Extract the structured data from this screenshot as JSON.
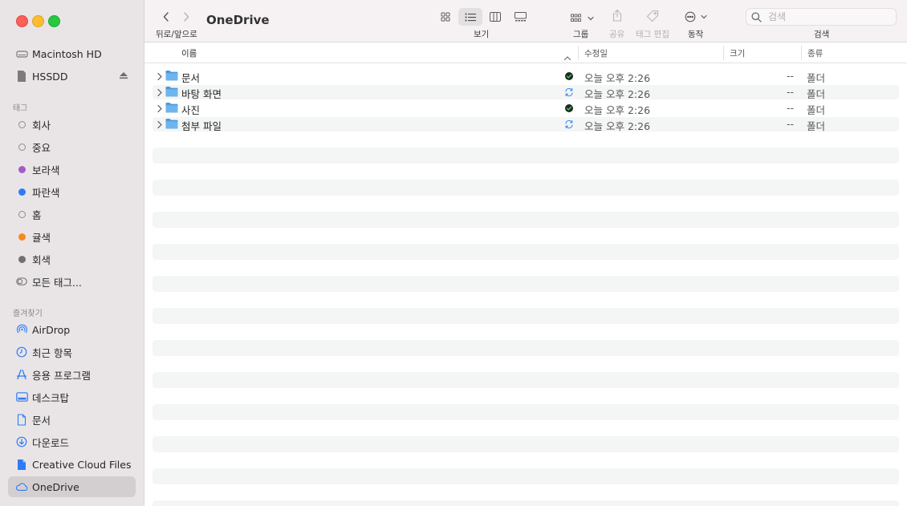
{
  "toolbar": {
    "title": "OneDrive",
    "nav_label": "뒤로/앞으로",
    "view_label": "보기",
    "group_label": "그룹",
    "share_label": "공유",
    "tag_edit_label": "태그 편집",
    "action_label": "동작",
    "search_label": "검색",
    "search_placeholder": "검색"
  },
  "sidebar": {
    "locations": [
      {
        "label": "Macintosh HD",
        "icon": "internal-disk-icon"
      },
      {
        "label": "HSSDD",
        "icon": "external-drive-icon",
        "ejectable": true
      }
    ],
    "tags_header": "태그",
    "tags": [
      {
        "label": "회사",
        "color": null
      },
      {
        "label": "중요",
        "color": null
      },
      {
        "label": "보라색",
        "color": "#a35bc7"
      },
      {
        "label": "파란색",
        "color": "#2f7bf5"
      },
      {
        "label": "홈",
        "color": null
      },
      {
        "label": "귤색",
        "color": "#f5891f"
      },
      {
        "label": "회색",
        "color": "#707070"
      },
      {
        "label": "모든 태그...",
        "color": null,
        "icon": "all-tags-icon"
      }
    ],
    "favorites_header": "즐겨찾기",
    "favorites": [
      {
        "label": "AirDrop",
        "icon": "airdrop-icon"
      },
      {
        "label": "최근 항목",
        "icon": "clock-icon"
      },
      {
        "label": "응용 프로그램",
        "icon": "applications-icon"
      },
      {
        "label": "데스크탑",
        "icon": "desktop-icon"
      },
      {
        "label": "문서",
        "icon": "document-icon"
      },
      {
        "label": "다운로드",
        "icon": "download-icon"
      },
      {
        "label": "Creative Cloud Files",
        "icon": "file-icon"
      },
      {
        "label": "OneDrive",
        "icon": "cloud-icon",
        "selected": true
      }
    ]
  },
  "columns": {
    "name": "이름",
    "modified": "수정일",
    "size": "크기",
    "kind": "종류"
  },
  "files": [
    {
      "name": "문서",
      "status": "synced",
      "modified": "오늘 오후 2:26",
      "size": "--",
      "kind": "폴더"
    },
    {
      "name": "바탕 화면",
      "status": "syncing",
      "modified": "오늘 오후 2:26",
      "size": "--",
      "kind": "폴더"
    },
    {
      "name": "사진",
      "status": "synced",
      "modified": "오늘 오후 2:26",
      "size": "--",
      "kind": "폴더"
    },
    {
      "name": "첨부 파일",
      "status": "syncing",
      "modified": "오늘 오후 2:26",
      "size": "--",
      "kind": "폴더"
    }
  ],
  "colors": {
    "sidebar_bg": "#e9e5e7",
    "toolbar_bg": "#f6f2f3",
    "folder_blue": "#6db5ee",
    "synced_green": "#1a9c3c",
    "syncing_blue": "#3b8ee8"
  }
}
